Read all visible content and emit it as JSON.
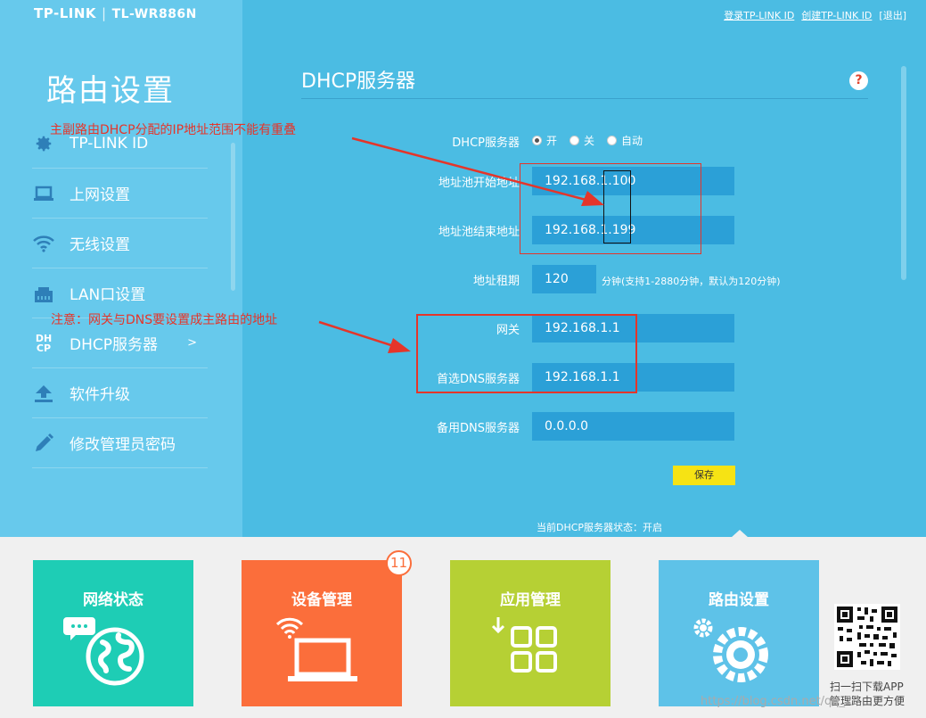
{
  "header": {
    "brand": "TP-LINK",
    "model": "TL-WR886N",
    "links": [
      "登录TP-LINK ID",
      "创建TP-LINK ID",
      "[退出]"
    ]
  },
  "sidebar": {
    "title": "路由设置",
    "items": [
      {
        "label": "TP-LINK ID",
        "icon": "gear-icon"
      },
      {
        "label": "上网设置",
        "icon": "laptop-icon"
      },
      {
        "label": "无线设置",
        "icon": "wifi-icon"
      },
      {
        "label": "LAN口设置",
        "icon": "lan-port-icon"
      },
      {
        "label": "DHCP服务器",
        "icon": "dhcp-icon",
        "active": true,
        "arrow": ">"
      },
      {
        "label": "软件升级",
        "icon": "upload-icon"
      },
      {
        "label": "修改管理员密码",
        "icon": "pencil-icon"
      }
    ]
  },
  "content": {
    "title": "DHCP服务器",
    "help": "?",
    "dhcp_label": "DHCP服务器",
    "radio_options": [
      "开",
      "关",
      "自动"
    ],
    "radio_selected": "开",
    "start_label": "地址池开始地址",
    "start_value": "192.168.1.100",
    "end_label": "地址池结束地址",
    "end_value": "192.168.1.199",
    "lease_label": "地址租期",
    "lease_value": "120",
    "lease_note": "分钟(支持1-2880分钟，默认为120分钟)",
    "gateway_label": "网关",
    "gateway_value": "192.168.1.1",
    "dns1_label": "首选DNS服务器",
    "dns1_value": "192.168.1.1",
    "dns2_label": "备用DNS服务器",
    "dns2_value": "0.0.0.0",
    "save_label": "保存",
    "status": "当前DHCP服务器状态：开启"
  },
  "annotations": {
    "note1": "主副路由DHCP分配的IP地址范围不能有重叠",
    "note2": "注意：网关与DNS要设置成主路由的地址",
    "color": "#e5352a"
  },
  "tiles": [
    {
      "label": "网络状态",
      "color": "#1ecdb5",
      "icon": "globe-chat-icon"
    },
    {
      "label": "设备管理",
      "color": "#fb6e3b",
      "icon": "laptop-wifi-icon"
    },
    {
      "label": "应用管理",
      "color": "#b6d034",
      "icon": "apps-grid-icon"
    },
    {
      "label": "路由设置",
      "color": "#5ec2e8",
      "icon": "gears-icon"
    }
  ],
  "badge": "11",
  "qr": {
    "line1": "扫一扫下载APP",
    "line2": "管理路由更方便"
  },
  "watermark": "https://blog.csdn.net/qq_29"
}
